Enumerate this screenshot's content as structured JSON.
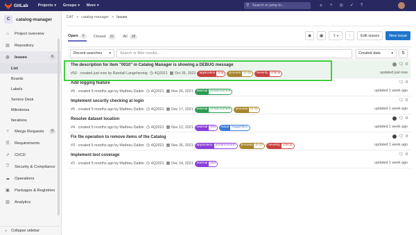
{
  "topbar": {
    "brand": "GitLab",
    "nav": [
      {
        "label": "Projects",
        "caret": "▾"
      },
      {
        "label": "Groups",
        "caret": "▾"
      },
      {
        "label": "More",
        "caret": "▾"
      }
    ],
    "search_placeholder": "Search or jump to...",
    "colors": {
      "bg": "#292961"
    }
  },
  "sidebar": {
    "project_initial": "C",
    "project_name": "catalog-manager",
    "items": [
      {
        "label": "Project overview",
        "icon": "home-icon"
      },
      {
        "label": "Repository",
        "icon": "document-icon"
      },
      {
        "label": "Issues",
        "icon": "issues-icon",
        "badge": "6"
      }
    ],
    "sub_items": [
      "List",
      "Boards",
      "Labels",
      "Service Desk",
      "Milestones",
      "Iterations"
    ],
    "lower_items": [
      {
        "label": "Merge Requests",
        "icon": "merge-request-icon",
        "badge": "0"
      },
      {
        "label": "Requirements",
        "icon": "requirements-icon"
      },
      {
        "label": "CI/CD",
        "icon": "rocket-icon"
      },
      {
        "label": "Security & Compliance",
        "icon": "shield-icon"
      },
      {
        "label": "Operations",
        "icon": "cloud-icon"
      },
      {
        "label": "Packages & Registries",
        "icon": "package-icon"
      },
      {
        "label": "Analytics",
        "icon": "chart-icon"
      }
    ],
    "collapse_label": "Collapse sidebar"
  },
  "breadcrumb": {
    "items": [
      "DAT",
      "catalog-manager",
      "Issues"
    ],
    "separator": ">"
  },
  "tabs": [
    {
      "label": "Open",
      "count": "6"
    },
    {
      "label": "Closed",
      "count": "32"
    },
    {
      "label": "All",
      "count": "38"
    }
  ],
  "toolbar": {
    "edit_label": "Edit issues",
    "new_label": "New issue"
  },
  "filter": {
    "recent_label": "Recent searches",
    "search_placeholder": "Search or filter results...",
    "sort_label": "Created date"
  },
  "issues": [
    {
      "title": "The description for item \"0010\" in Catalog Manager is showing a DEBUG message",
      "meta": "#50 · created just now by Randall Langehennig",
      "milestone": "4Q2021",
      "date": "Oct 26, 2021",
      "labels": [
        {
          "k": "application",
          "v": "bug",
          "color": "#c73f3f"
        },
        {
          "k": "process",
          "v": "to-do",
          "color": "#a8842a"
        },
        {
          "k": "severity",
          "v": "critical",
          "color": "#c73f3f"
        }
      ],
      "comments": "0",
      "updated": "updated just now",
      "avatar_color": "#8a8a8a"
    },
    {
      "title": "Add logging feature",
      "meta": "#6 · created 5 months ago by Mathieu Dalbin",
      "milestone": "4Q2021",
      "date": "Nov 26, 2021",
      "labels": [
        {
          "k": "internal",
          "v": "enhancement",
          "color": "#2f9a54"
        }
      ],
      "comments": "0",
      "updated": "updated 1 week ago",
      "avatar_color": ""
    },
    {
      "title": "Implement security checking at login",
      "meta": "#5 · created 5 months ago by Mathieu Dalbin",
      "milestone": "4Q2021",
      "date": "Dec 17, 2021",
      "labels": [
        {
          "k": "internal",
          "v": "enhancement",
          "color": "#2f9a54"
        },
        {
          "k": "process",
          "v": "to-do",
          "color": "#a8842a"
        }
      ],
      "comments": "0",
      "updated": "updated 1 week ago",
      "avatar_color": ""
    },
    {
      "title": "Resolve dataset location",
      "meta": "#4 · created 5 months ago by Mathieu Dalbin",
      "milestone": "4Q2021",
      "date": "Nov 12, 2021",
      "labels": [
        {
          "k": "internal",
          "v": "test",
          "color": "#8b3fd9"
        },
        {
          "k": "issue",
          "v": "suggestion",
          "color": "#3b7bd6"
        }
      ],
      "comments": "0",
      "updated": "updated 1 week ago",
      "avatar_color": "#444444"
    },
    {
      "title": "Fix file operation to remove items of the Catalog",
      "meta": "#3 · created 5 months ago by Mathieu Dalbin",
      "milestone": "4Q2021",
      "date": "Nov 26, 2021",
      "labels": [
        {
          "k": "application",
          "v": "enhancement",
          "color": "#8b3fd9"
        },
        {
          "k": "process",
          "v": "to-do",
          "color": "#a8842a"
        },
        {
          "k": "severity",
          "v": "critical",
          "color": "#c73f3f"
        }
      ],
      "comments": "0",
      "updated": "updated 1 week ago",
      "avatar_color": "#444444"
    },
    {
      "title": "Implement test coverage",
      "meta": "#2 · created 5 months ago by Mathieu Dalbin",
      "milestone": "4Q2021",
      "date": "Dec 24, 2021",
      "labels": [
        {
          "k": "internal",
          "v": "test",
          "color": "#8b3fd9"
        }
      ],
      "comments": "0",
      "updated": "updated 1 week ago",
      "avatar_color": ""
    }
  ]
}
